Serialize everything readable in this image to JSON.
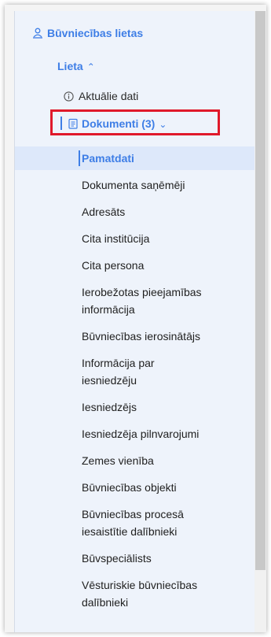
{
  "tree": {
    "root_label": "Būvniecības lietas",
    "case_label": "Lieta",
    "current_data_label": "Aktuālie dati",
    "documents_label": "Dokumenti (3)",
    "sections": [
      {
        "lines": [
          "Pamatdati"
        ],
        "active": true
      },
      {
        "lines": [
          "Dokumenta saņēmēji"
        ]
      },
      {
        "lines": [
          "Adresāts"
        ]
      },
      {
        "lines": [
          "Cita institūcija"
        ]
      },
      {
        "lines": [
          "Cita persona"
        ]
      },
      {
        "lines": [
          "Ierobežotas pieejamības",
          "informācija"
        ]
      },
      {
        "lines": [
          "Būvniecības ierosinātājs"
        ]
      },
      {
        "lines": [
          "Informācija par",
          "iesniedzēju"
        ]
      },
      {
        "lines": [
          "Iesniedzējs"
        ]
      },
      {
        "lines": [
          "Iesniedzēja pilnvarojumi"
        ]
      },
      {
        "lines": [
          "Zemes vienība"
        ]
      },
      {
        "lines": [
          "Būvniecības objekti"
        ]
      },
      {
        "lines": [
          "Būvniecības procesā",
          "iesaistītie dalībnieki"
        ]
      },
      {
        "lines": [
          "Būvspeciālists"
        ]
      },
      {
        "lines": [
          "Vēsturiskie būvniecības",
          "dalībnieki"
        ]
      }
    ]
  },
  "icons": {
    "root": "building-person-icon",
    "case_toggle": "chevron-up-icon",
    "current_data": "info-circle-icon",
    "documents": "document-icon",
    "documents_toggle": "chevron-down-icon"
  },
  "colors": {
    "accent": "#3e7ee6",
    "active_background": "#dde8fa",
    "panel_background": "#eef3fb",
    "highlight_box": "#e0192a"
  }
}
